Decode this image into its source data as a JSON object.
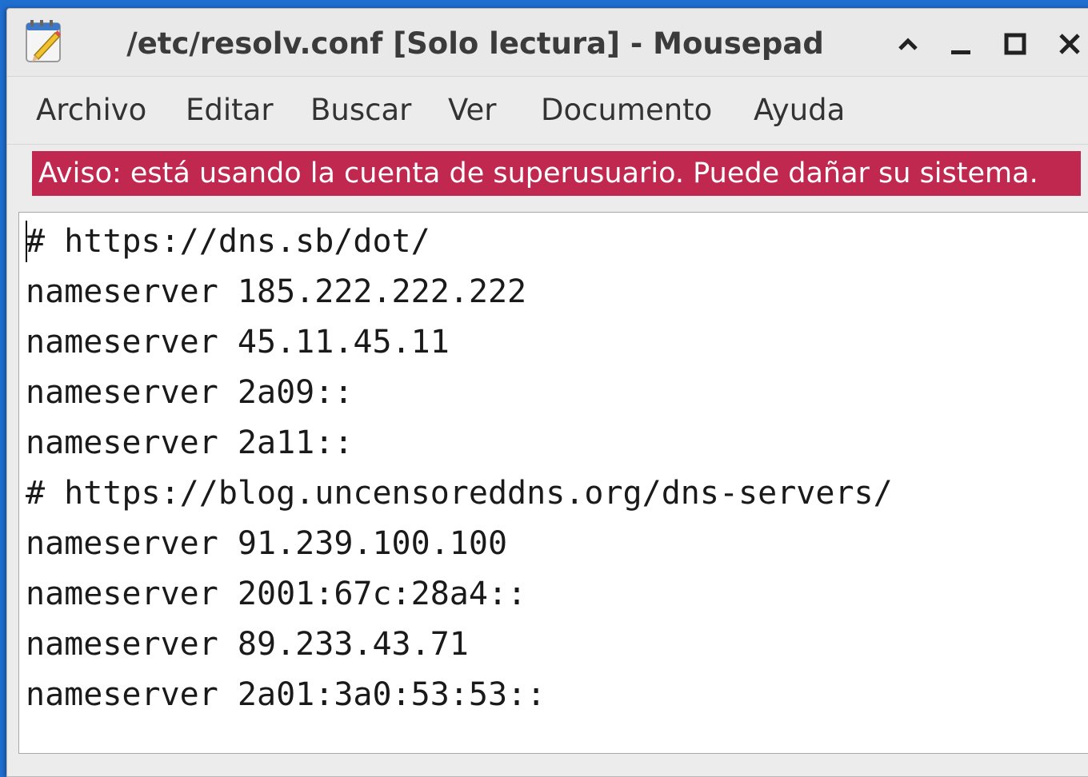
{
  "window": {
    "title": "/etc/resolv.conf [Solo lectura] - Mousepad",
    "controls": [
      "shade-icon",
      "minimize-icon",
      "maximize-icon",
      "close-icon"
    ]
  },
  "menu": {
    "items": [
      {
        "label": "Archivo"
      },
      {
        "label": "Editar"
      },
      {
        "label": "Buscar"
      },
      {
        "label": "Ver"
      },
      {
        "label": "Documento"
      },
      {
        "label": "Ayuda"
      }
    ]
  },
  "warning": {
    "text": "Aviso: está usando la cuenta de superusuario. Puede dañar su sistema.",
    "color": "#c0284f"
  },
  "editor": {
    "lines": [
      "# https://dns.sb/dot/",
      "nameserver 185.222.222.222",
      "nameserver 45.11.45.11",
      "nameserver 2a09::",
      "nameserver 2a11::",
      "# https://blog.uncensoreddns.org/dns-servers/",
      "nameserver 91.239.100.100",
      "nameserver 2001:67c:28a4::",
      "nameserver 89.233.43.71",
      "nameserver 2a01:3a0:53:53::"
    ]
  },
  "colors": {
    "desktop": "#1f6fd1",
    "accent": "#c0284f"
  }
}
